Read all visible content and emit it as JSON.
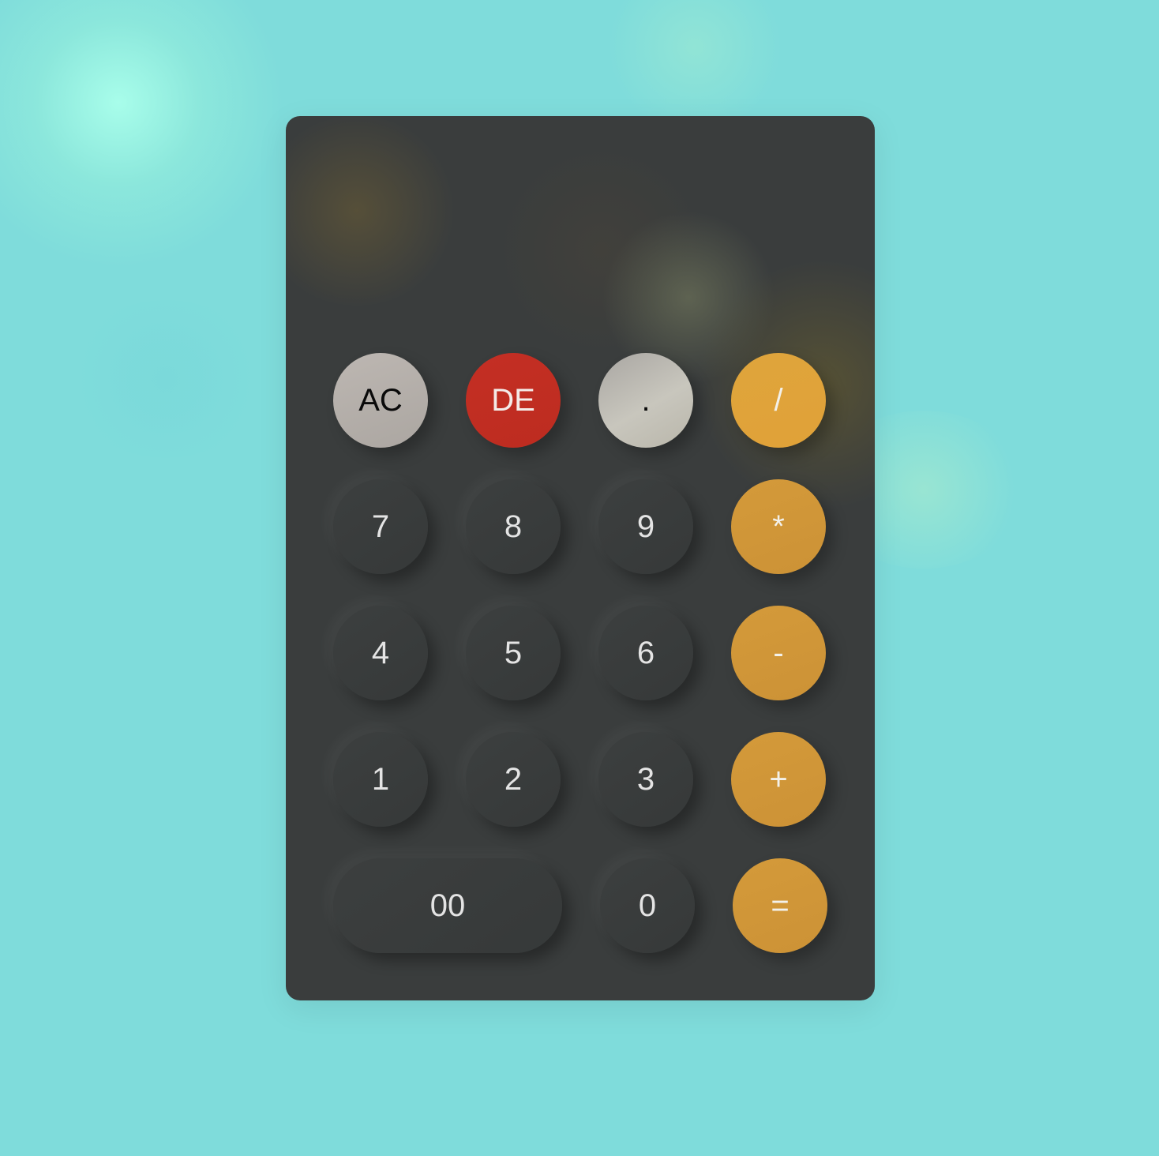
{
  "display": {
    "value": ""
  },
  "keys": {
    "row1": {
      "clear": "AC",
      "delete": "DE",
      "decimal": ".",
      "divide": "/"
    },
    "row2": {
      "seven": "7",
      "eight": "8",
      "nine": "9",
      "multiply": "*"
    },
    "row3": {
      "four": "4",
      "five": "5",
      "six": "6",
      "subtract": "-"
    },
    "row4": {
      "one": "1",
      "two": "2",
      "three": "3",
      "add": "+"
    },
    "row5": {
      "double_zero": "00",
      "zero": "0",
      "equals": "="
    }
  },
  "colors": {
    "background": "#7fdcdb",
    "calculator_body": "#3a3d3d",
    "operator_orange": "#d1973a",
    "delete_red": "#c22e22",
    "clear_gray": "#b5b0ab",
    "number_key": "#393c3c"
  }
}
